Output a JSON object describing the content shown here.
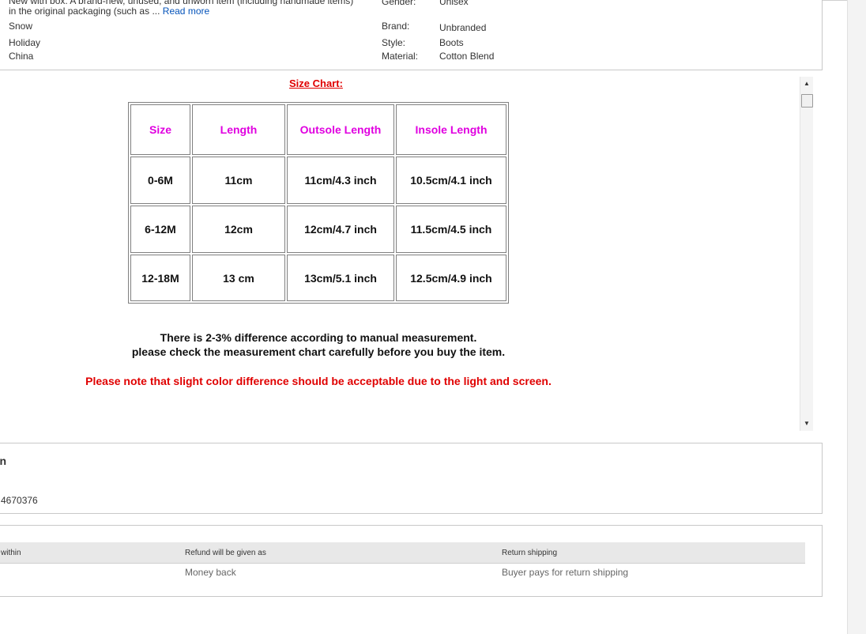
{
  "item_specifics": {
    "condition_text": "New with box: A brand-new, unused, and unworn item (including handmade items) in the original packaging (such as ...",
    "read_more": "Read more",
    "left_values": [
      "Snow",
      "Holiday",
      "China"
    ],
    "gender_label": "Gender:",
    "gender_value": "Unisex",
    "brand_label": "Brand:",
    "brand_value": "Unbranded",
    "style_label": "Style:",
    "style_value": "Boots",
    "material_label": "Material:",
    "material_value": "Cotton Blend"
  },
  "description": {
    "size_chart_title": "Size Chart:",
    "table": {
      "headers": [
        "Size",
        "Length",
        "Outsole Length",
        "Insole Length"
      ],
      "rows": [
        [
          "0-6M",
          "11cm",
          "11cm/4.3 inch",
          "10.5cm/4.1 inch"
        ],
        [
          "6-12M",
          "12cm",
          "12cm/4.7 inch",
          "11.5cm/4.5 inch"
        ],
        [
          "12-18M",
          "13 cm",
          "13cm/5.1 inch",
          "12.5cm/4.9 inch"
        ]
      ]
    },
    "measure_note_1": "There is 2-3% difference according to manual measurement.",
    "measure_note_2": "please check the measurement chart carefully before you buy the item.",
    "color_note": "Please note that slight color difference should be acceptable due to the light and screen."
  },
  "shipping_section": {
    "heading_fragment": "on",
    "item_number_fragment": "4670376"
  },
  "returns": {
    "col1_header": "within",
    "col2_header": "Refund will be given as",
    "col3_header": "Return shipping",
    "col2_value": "Money back",
    "col3_value": "Buyer pays for return shipping"
  },
  "scroll": {
    "up_arrow": "▲",
    "down_arrow": "▼"
  },
  "colors": {
    "header_magenta": "#e000e0",
    "note_red": "#e00000",
    "link_blue": "#0654ba"
  }
}
